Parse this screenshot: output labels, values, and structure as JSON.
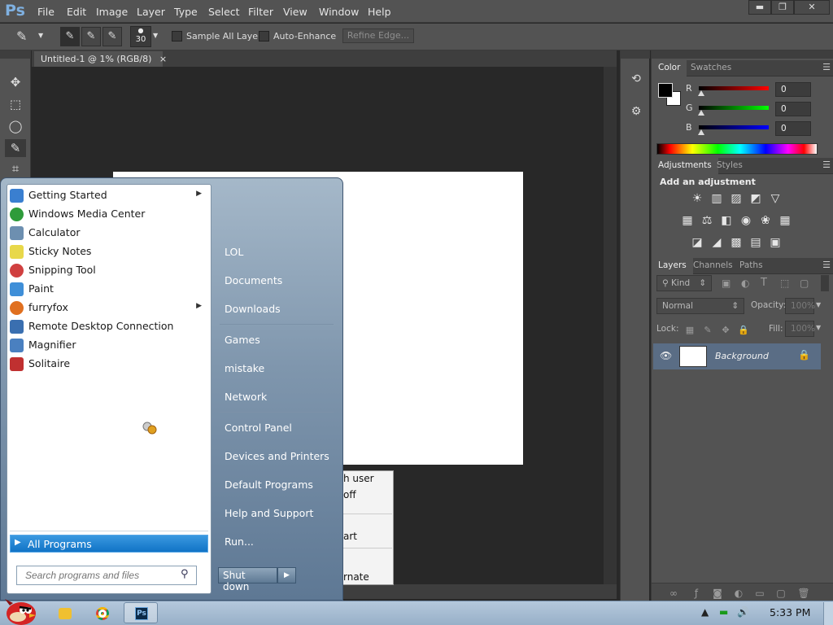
{
  "app": {
    "logo": "Ps"
  },
  "menu": [
    "File",
    "Edit",
    "Image",
    "Layer",
    "Type",
    "Select",
    "Filter",
    "View",
    "Window",
    "Help"
  ],
  "window_controls": {
    "minimize": "▬",
    "restore": "❐",
    "close": "✕"
  },
  "options": {
    "brush_size": "30",
    "sample_all_layers": "Sample All Layers",
    "auto_enhance": "Auto-Enhance",
    "refine_edge": "Refine Edge..."
  },
  "document": {
    "tab_title": "Untitled-1 @ 1% (RGB/8)",
    "close": "×"
  },
  "color_panel": {
    "tabs": [
      "Color",
      "Swatches"
    ],
    "channels": [
      {
        "label": "R",
        "value": "0",
        "color": "#e02020"
      },
      {
        "label": "G",
        "value": "0",
        "color": "#20c020"
      },
      {
        "label": "B",
        "value": "0",
        "color": "#2040e0"
      }
    ]
  },
  "adjustments_panel": {
    "tabs": [
      "Adjustments",
      "Styles"
    ],
    "heading": "Add an adjustment"
  },
  "layers_panel": {
    "tabs": [
      "Layers",
      "Channels",
      "Paths"
    ],
    "kind": "Kind",
    "blend_mode": "Normal",
    "opacity_label": "Opacity:",
    "opacity_value": "100%",
    "lock_label": "Lock:",
    "fill_label": "Fill:",
    "fill_value": "100%",
    "layer_name": "Background"
  },
  "context_menu": [
    "h user",
    "off",
    "",
    "art",
    "",
    "rnate"
  ],
  "start_menu": {
    "programs": [
      {
        "label": "Getting Started",
        "submenu": true,
        "color": "#3a7fd0"
      },
      {
        "label": "Windows Media Center",
        "submenu": false,
        "color": "#2e9b3a"
      },
      {
        "label": "Calculator",
        "submenu": false,
        "color": "#6d8fb0"
      },
      {
        "label": "Sticky Notes",
        "submenu": false,
        "color": "#e8d84a"
      },
      {
        "label": "Snipping Tool",
        "submenu": false,
        "color": "#d04040"
      },
      {
        "label": "Paint",
        "submenu": false,
        "color": "#3f8fd8"
      },
      {
        "label": "furryfox",
        "submenu": true,
        "color": "#e07020"
      },
      {
        "label": "Remote Desktop Connection",
        "submenu": false,
        "color": "#3a6fb0"
      },
      {
        "label": "Magnifier",
        "submenu": false,
        "color": "#4a80c0"
      },
      {
        "label": "Solitaire",
        "submenu": false,
        "color": "#c03030"
      }
    ],
    "all_programs": "All Programs",
    "search_placeholder": "Search programs and files",
    "right_links": [
      "LOL",
      "Documents",
      "Downloads",
      "Games",
      "mistake",
      "Network",
      "Control Panel",
      "Devices and Printers",
      "Default Programs",
      "Help and Support",
      "Run..."
    ],
    "shutdown": "Shut down"
  },
  "taskbar": {
    "clock": "5:33 PM",
    "tray": [
      "▲",
      "▬",
      "🔊"
    ]
  }
}
